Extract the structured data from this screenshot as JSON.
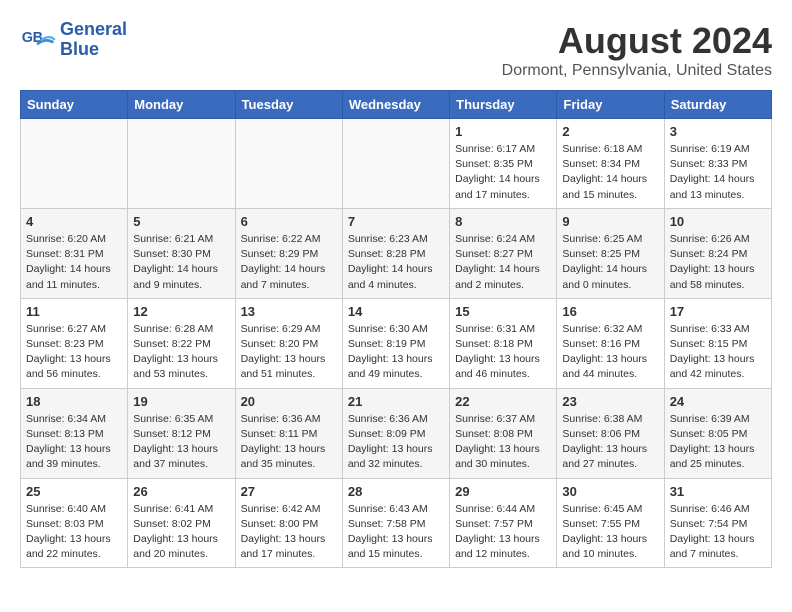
{
  "header": {
    "logo_line1": "General",
    "logo_line2": "Blue",
    "month_year": "August 2024",
    "location": "Dormont, Pennsylvania, United States"
  },
  "days_of_week": [
    "Sunday",
    "Monday",
    "Tuesday",
    "Wednesday",
    "Thursday",
    "Friday",
    "Saturday"
  ],
  "weeks": [
    [
      {
        "day": "",
        "info": ""
      },
      {
        "day": "",
        "info": ""
      },
      {
        "day": "",
        "info": ""
      },
      {
        "day": "",
        "info": ""
      },
      {
        "day": "1",
        "info": "Sunrise: 6:17 AM\nSunset: 8:35 PM\nDaylight: 14 hours\nand 17 minutes."
      },
      {
        "day": "2",
        "info": "Sunrise: 6:18 AM\nSunset: 8:34 PM\nDaylight: 14 hours\nand 15 minutes."
      },
      {
        "day": "3",
        "info": "Sunrise: 6:19 AM\nSunset: 8:33 PM\nDaylight: 14 hours\nand 13 minutes."
      }
    ],
    [
      {
        "day": "4",
        "info": "Sunrise: 6:20 AM\nSunset: 8:31 PM\nDaylight: 14 hours\nand 11 minutes."
      },
      {
        "day": "5",
        "info": "Sunrise: 6:21 AM\nSunset: 8:30 PM\nDaylight: 14 hours\nand 9 minutes."
      },
      {
        "day": "6",
        "info": "Sunrise: 6:22 AM\nSunset: 8:29 PM\nDaylight: 14 hours\nand 7 minutes."
      },
      {
        "day": "7",
        "info": "Sunrise: 6:23 AM\nSunset: 8:28 PM\nDaylight: 14 hours\nand 4 minutes."
      },
      {
        "day": "8",
        "info": "Sunrise: 6:24 AM\nSunset: 8:27 PM\nDaylight: 14 hours\nand 2 minutes."
      },
      {
        "day": "9",
        "info": "Sunrise: 6:25 AM\nSunset: 8:25 PM\nDaylight: 14 hours\nand 0 minutes."
      },
      {
        "day": "10",
        "info": "Sunrise: 6:26 AM\nSunset: 8:24 PM\nDaylight: 13 hours\nand 58 minutes."
      }
    ],
    [
      {
        "day": "11",
        "info": "Sunrise: 6:27 AM\nSunset: 8:23 PM\nDaylight: 13 hours\nand 56 minutes."
      },
      {
        "day": "12",
        "info": "Sunrise: 6:28 AM\nSunset: 8:22 PM\nDaylight: 13 hours\nand 53 minutes."
      },
      {
        "day": "13",
        "info": "Sunrise: 6:29 AM\nSunset: 8:20 PM\nDaylight: 13 hours\nand 51 minutes."
      },
      {
        "day": "14",
        "info": "Sunrise: 6:30 AM\nSunset: 8:19 PM\nDaylight: 13 hours\nand 49 minutes."
      },
      {
        "day": "15",
        "info": "Sunrise: 6:31 AM\nSunset: 8:18 PM\nDaylight: 13 hours\nand 46 minutes."
      },
      {
        "day": "16",
        "info": "Sunrise: 6:32 AM\nSunset: 8:16 PM\nDaylight: 13 hours\nand 44 minutes."
      },
      {
        "day": "17",
        "info": "Sunrise: 6:33 AM\nSunset: 8:15 PM\nDaylight: 13 hours\nand 42 minutes."
      }
    ],
    [
      {
        "day": "18",
        "info": "Sunrise: 6:34 AM\nSunset: 8:13 PM\nDaylight: 13 hours\nand 39 minutes."
      },
      {
        "day": "19",
        "info": "Sunrise: 6:35 AM\nSunset: 8:12 PM\nDaylight: 13 hours\nand 37 minutes."
      },
      {
        "day": "20",
        "info": "Sunrise: 6:36 AM\nSunset: 8:11 PM\nDaylight: 13 hours\nand 35 minutes."
      },
      {
        "day": "21",
        "info": "Sunrise: 6:36 AM\nSunset: 8:09 PM\nDaylight: 13 hours\nand 32 minutes."
      },
      {
        "day": "22",
        "info": "Sunrise: 6:37 AM\nSunset: 8:08 PM\nDaylight: 13 hours\nand 30 minutes."
      },
      {
        "day": "23",
        "info": "Sunrise: 6:38 AM\nSunset: 8:06 PM\nDaylight: 13 hours\nand 27 minutes."
      },
      {
        "day": "24",
        "info": "Sunrise: 6:39 AM\nSunset: 8:05 PM\nDaylight: 13 hours\nand 25 minutes."
      }
    ],
    [
      {
        "day": "25",
        "info": "Sunrise: 6:40 AM\nSunset: 8:03 PM\nDaylight: 13 hours\nand 22 minutes."
      },
      {
        "day": "26",
        "info": "Sunrise: 6:41 AM\nSunset: 8:02 PM\nDaylight: 13 hours\nand 20 minutes."
      },
      {
        "day": "27",
        "info": "Sunrise: 6:42 AM\nSunset: 8:00 PM\nDaylight: 13 hours\nand 17 minutes."
      },
      {
        "day": "28",
        "info": "Sunrise: 6:43 AM\nSunset: 7:58 PM\nDaylight: 13 hours\nand 15 minutes."
      },
      {
        "day": "29",
        "info": "Sunrise: 6:44 AM\nSunset: 7:57 PM\nDaylight: 13 hours\nand 12 minutes."
      },
      {
        "day": "30",
        "info": "Sunrise: 6:45 AM\nSunset: 7:55 PM\nDaylight: 13 hours\nand 10 minutes."
      },
      {
        "day": "31",
        "info": "Sunrise: 6:46 AM\nSunset: 7:54 PM\nDaylight: 13 hours\nand 7 minutes."
      }
    ]
  ]
}
